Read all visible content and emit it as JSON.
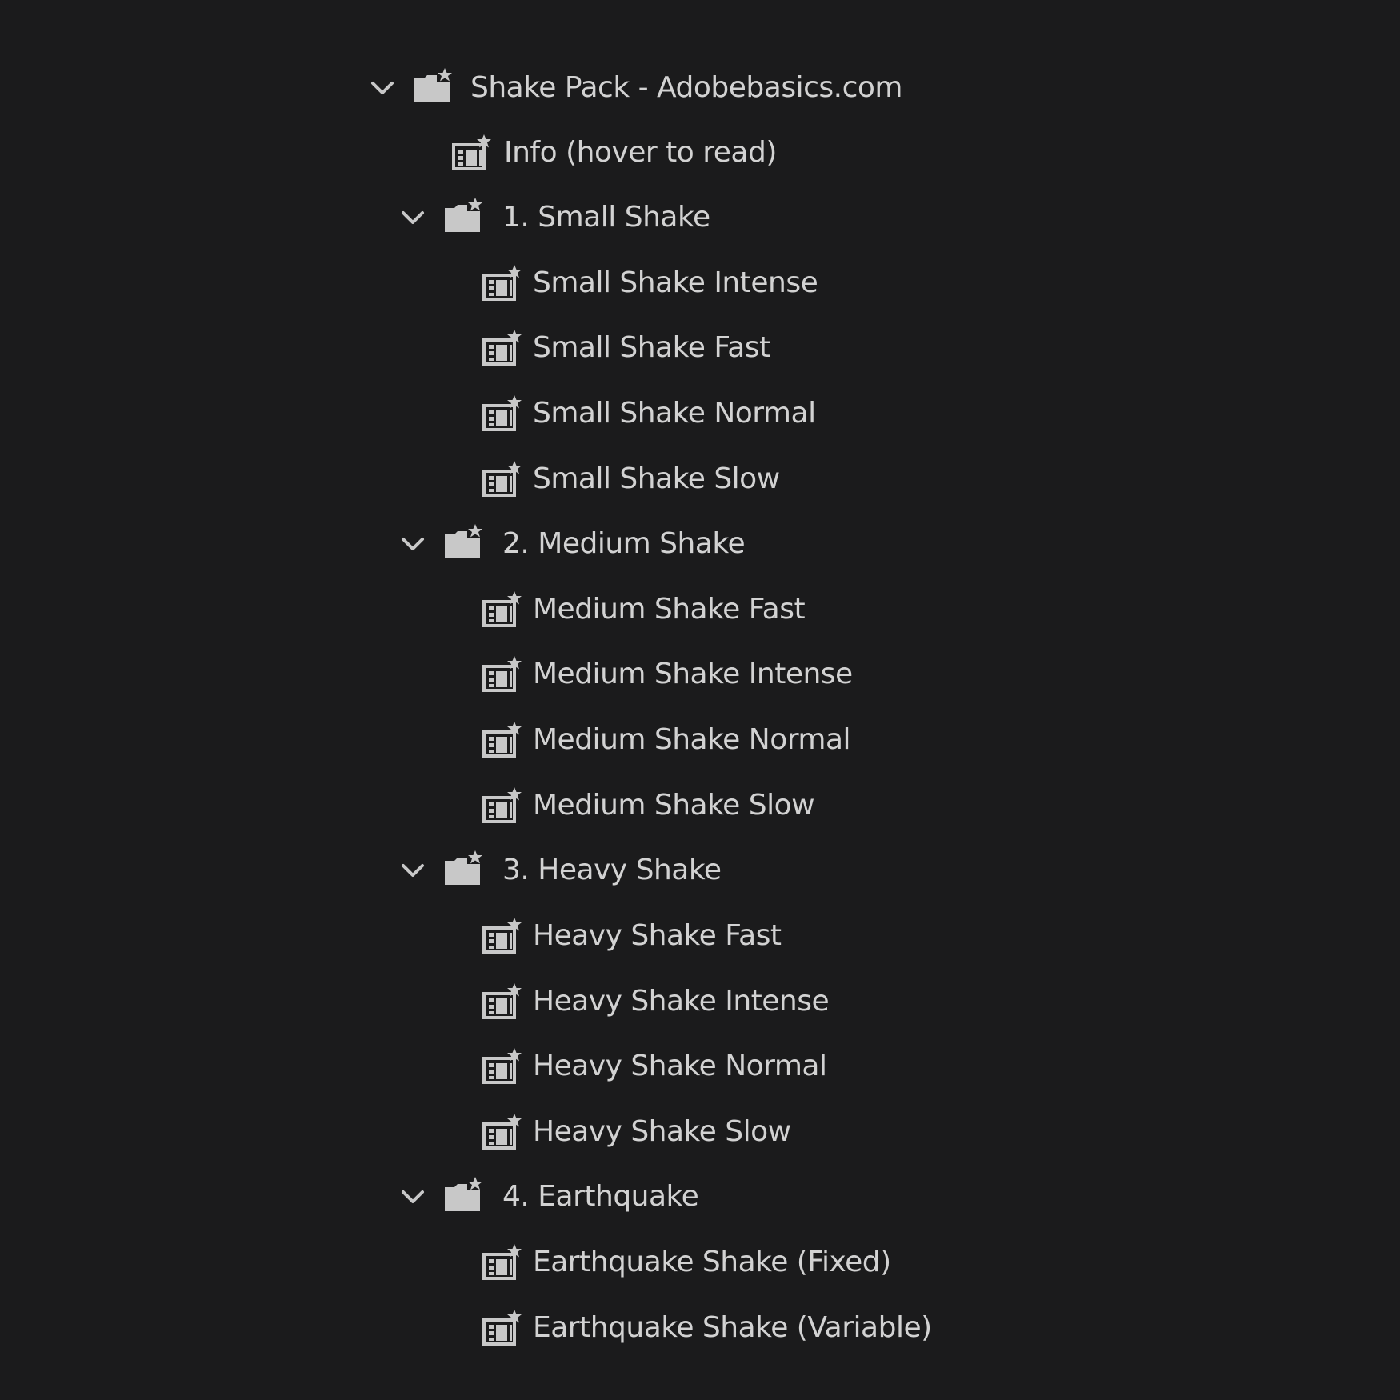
{
  "colors": {
    "background": "#1b1b1c",
    "text": "#d2d2d2",
    "icon": "#c8c8c8"
  },
  "root": {
    "label": "Shake Pack - Adobebasics.com",
    "expanded": true,
    "icon": "bin-star-icon"
  },
  "info_item": {
    "label": "Info (hover to read)",
    "icon": "sequence-star-icon"
  },
  "folders": [
    {
      "label": "1. Small Shake",
      "expanded": true,
      "items": [
        "Small Shake Intense",
        "Small Shake Fast",
        "Small Shake Normal",
        "Small Shake Slow"
      ]
    },
    {
      "label": "2. Medium Shake",
      "expanded": true,
      "items": [
        "Medium Shake Fast",
        "Medium Shake Intense",
        "Medium Shake Normal",
        "Medium Shake Slow"
      ]
    },
    {
      "label": "3. Heavy Shake",
      "expanded": true,
      "items": [
        "Heavy Shake Fast",
        "Heavy Shake Intense",
        "Heavy Shake Normal",
        "Heavy Shake Slow"
      ]
    },
    {
      "label": "4. Earthquake",
      "expanded": true,
      "items": [
        "Earthquake Shake (Fixed)",
        "Earthquake Shake (Variable)"
      ]
    }
  ]
}
